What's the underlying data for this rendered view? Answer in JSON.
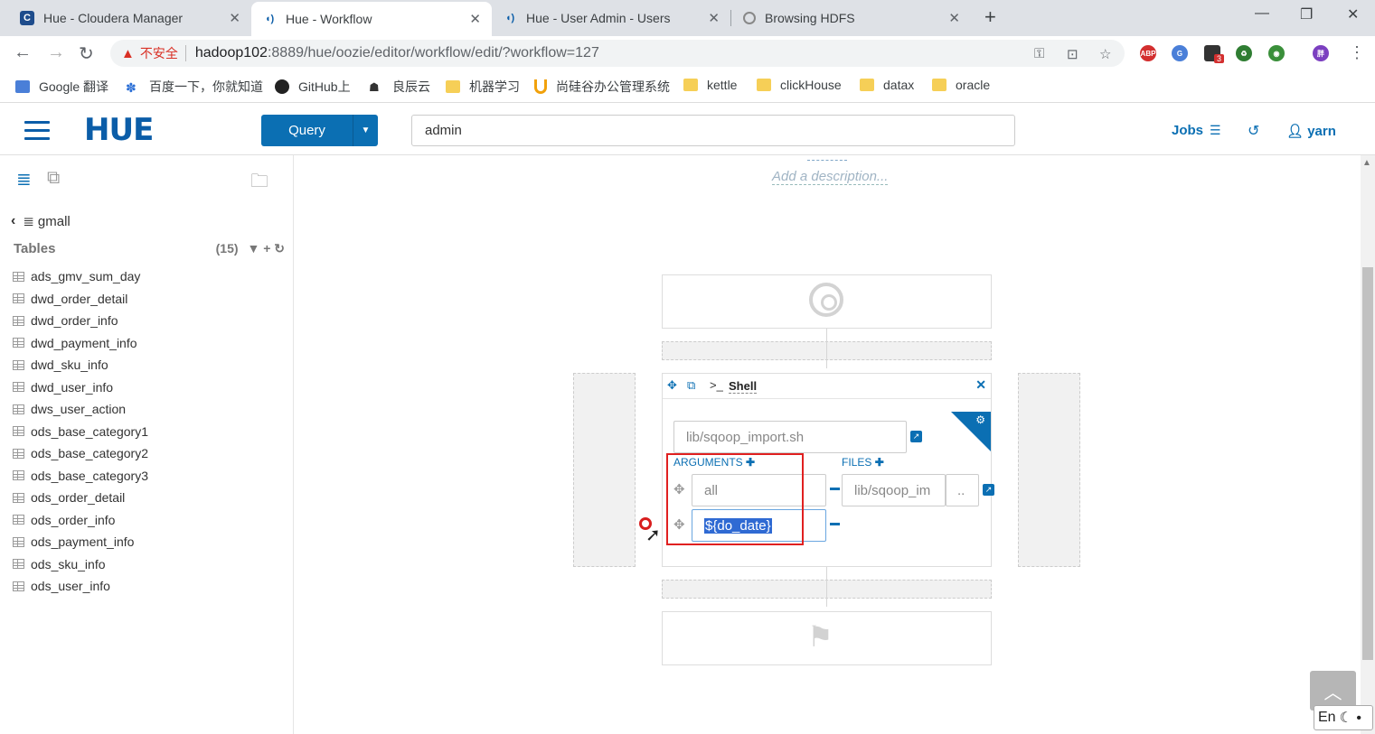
{
  "browser": {
    "tabs": [
      {
        "title": "Hue - Cloudera Manager",
        "favicon": "C"
      },
      {
        "title": "Hue - Workflow",
        "favicon": "hue"
      },
      {
        "title": "Hue - User Admin - Users",
        "favicon": "hue"
      },
      {
        "title": "Browsing HDFS",
        "favicon": "globe"
      }
    ],
    "security_warning": "不安全",
    "url_host": "hadoop102",
    "url_path": ":8889/hue/oozie/editor/workflow/edit/?workflow=127",
    "extension_badge": "3",
    "bookmarks": [
      {
        "label": "Google 翻译",
        "icon": "google-translate-icon"
      },
      {
        "label": "百度一下，你就知道",
        "icon": "baidu-paw-icon"
      },
      {
        "label": "GitHub上",
        "icon": "github-icon"
      },
      {
        "label": "良辰云",
        "icon": "cloud-icon"
      },
      {
        "label": "机器学习",
        "icon": "folder-icon"
      },
      {
        "label": "尚硅谷办公管理系统",
        "icon": "u-icon"
      },
      {
        "label": "kettle",
        "icon": "folder-icon"
      },
      {
        "label": "clickHouse",
        "icon": "folder-icon"
      },
      {
        "label": "datax",
        "icon": "folder-icon"
      },
      {
        "label": "oracle",
        "icon": "folder-icon"
      }
    ]
  },
  "hue": {
    "logo": "HUE",
    "query_button": "Query",
    "search_value": "admin",
    "jobs_label": "Jobs",
    "user_label": "yarn"
  },
  "left_panel": {
    "database": "gmall",
    "tables_label": "Tables",
    "tables_count": "(15)",
    "tables": [
      "ads_gmv_sum_day",
      "dwd_order_detail",
      "dwd_order_info",
      "dwd_payment_info",
      "dwd_sku_info",
      "dwd_user_info",
      "dws_user_action",
      "ods_base_category1",
      "ods_base_category2",
      "ods_base_category3",
      "ods_order_detail",
      "ods_order_info",
      "ods_payment_info",
      "ods_sku_info",
      "ods_user_info"
    ]
  },
  "workflow": {
    "description_placeholder": "Add a description...",
    "shell": {
      "title": "Shell",
      "script_path": "lib/sqoop_import.sh",
      "arguments_label": "ARGUMENTS",
      "files_label": "FILES",
      "arguments": [
        "all",
        "${do_date}"
      ],
      "files": [
        "lib/sqoop_im"
      ],
      "files_browse": ".."
    }
  },
  "ime": {
    "label": "En"
  },
  "colors": {
    "hue_blue": "#0b6fb3",
    "highlight_red": "#e02020",
    "selection": "#2f6ad3"
  }
}
